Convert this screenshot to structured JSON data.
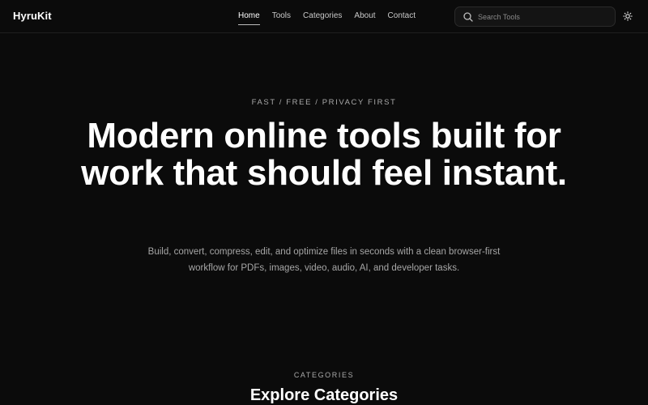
{
  "header": {
    "logo": "HyruKit",
    "nav": [
      {
        "label": "Home",
        "active": true
      },
      {
        "label": "Tools",
        "active": false
      },
      {
        "label": "Categories",
        "active": false
      },
      {
        "label": "About",
        "active": false
      },
      {
        "label": "Contact",
        "active": false
      }
    ],
    "search": {
      "placeholder": "Search Tools",
      "value": "",
      "icon": "search-icon"
    },
    "theme_toggle_icon": "sun-icon"
  },
  "hero": {
    "eyebrow": "FAST / FREE / PRIVACY FIRST",
    "headline": "Modern online tools built for work that should feel instant.",
    "subtext": "Build, convert, compress, edit, and optimize files in seconds with a clean browser-first workflow for PDFs, images, video, audio, AI, and developer tasks."
  },
  "categories_section": {
    "label": "CATEGORIES",
    "title": "Explore Categories"
  },
  "colors": {
    "background": "#0b0b0b",
    "text_primary": "#ffffff",
    "text_muted": "#a6a6a6",
    "border": "#1f1f1f"
  }
}
